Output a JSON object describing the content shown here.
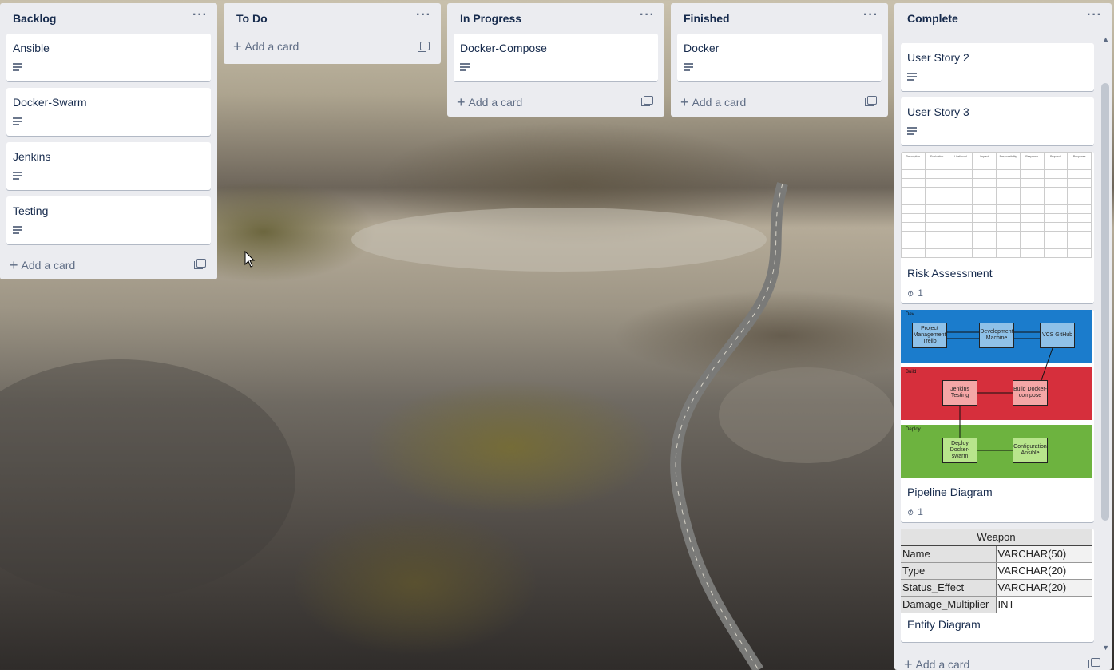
{
  "lists": [
    {
      "title": "Backlog",
      "menu_glyph": "···",
      "cards": [
        {
          "title": "Ansible"
        },
        {
          "title": "Docker-Swarm"
        },
        {
          "title": "Jenkins"
        },
        {
          "title": "Testing"
        }
      ],
      "add_label": "Add a card"
    },
    {
      "title": "To Do",
      "menu_glyph": "···",
      "cards": [],
      "add_label": "Add a card"
    },
    {
      "title": "In Progress",
      "menu_glyph": "···",
      "cards": [
        {
          "title": "Docker-Compose"
        }
      ],
      "add_label": "Add a card"
    },
    {
      "title": "Finished",
      "menu_glyph": "···",
      "cards": [
        {
          "title": "Docker"
        }
      ],
      "add_label": "Add a card"
    },
    {
      "title": "Complete",
      "menu_glyph": "···",
      "cards": [
        {
          "title": "User Story 2"
        },
        {
          "title": "User Story 3"
        },
        {
          "title": "Risk Assessment",
          "attachments": "1"
        },
        {
          "title": "Pipeline Diagram",
          "attachments": "1"
        },
        {
          "title": "Entity Diagram"
        }
      ],
      "add_label": "Add a card"
    }
  ],
  "pipeline_cover": {
    "bands": [
      {
        "label": "Dev",
        "color": "#1b7ccc"
      },
      {
        "label": "Build",
        "color": "#d62f3c"
      },
      {
        "label": "Deploy",
        "color": "#6db33f"
      }
    ],
    "boxes": [
      {
        "text": "Project Management Trello"
      },
      {
        "text": "Development Machine"
      },
      {
        "text": "VCS GitHub"
      },
      {
        "text": "Jenkins Testing"
      },
      {
        "text": "Build Docker-compose"
      },
      {
        "text": "Deploy Docker-swarm"
      },
      {
        "text": "Configuration Ansible"
      }
    ]
  },
  "entity_cover": {
    "table_name": "Weapon",
    "fields": [
      {
        "name": "Name",
        "type": "VARCHAR(50)"
      },
      {
        "name": "Type",
        "type": "VARCHAR(20)"
      },
      {
        "name": "Status_Effect",
        "type": "VARCHAR(20)"
      },
      {
        "name": "Damage_Multiplier",
        "type": "INT"
      }
    ]
  },
  "risk_cover": {
    "headers": [
      "Description",
      "Evaluation",
      "Likelihood",
      "Impact",
      "Responsibility",
      "Response",
      "Proposal",
      "Response"
    ]
  },
  "icons": {
    "paperclip": "paperclip-icon",
    "description": "description-icon",
    "template": "card-template-icon",
    "menu": "list-menu-icon"
  },
  "colors": {
    "list_bg": "#ebecf0",
    "card_bg": "#ffffff",
    "text": "#172b4d",
    "muted": "#5e6c84"
  }
}
